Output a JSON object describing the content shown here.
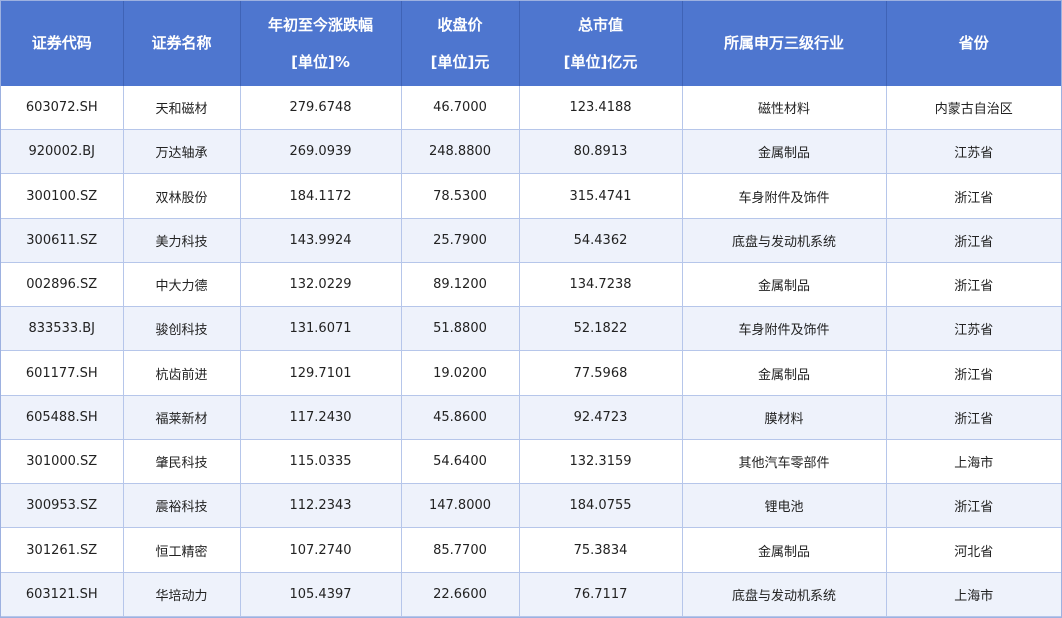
{
  "headers": [
    {
      "line1": "证券代码",
      "line2": ""
    },
    {
      "line1": "证券名称",
      "line2": ""
    },
    {
      "line1": "年初至今涨跌幅",
      "line2": "[单位]%"
    },
    {
      "line1": "收盘价",
      "line2": "[单位]元"
    },
    {
      "line1": "总市值",
      "line2": "[单位]亿元"
    },
    {
      "line1": "所属申万三级行业",
      "line2": ""
    },
    {
      "line1": "省份",
      "line2": ""
    }
  ],
  "rows": [
    [
      "603072.SH",
      "天和磁材",
      "279.6748",
      "46.7000",
      "123.4188",
      "磁性材料",
      "内蒙古自治区"
    ],
    [
      "920002.BJ",
      "万达轴承",
      "269.0939",
      "248.8800",
      "80.8913",
      "金属制品",
      "江苏省"
    ],
    [
      "300100.SZ",
      "双林股份",
      "184.1172",
      "78.5300",
      "315.4741",
      "车身附件及饰件",
      "浙江省"
    ],
    [
      "300611.SZ",
      "美力科技",
      "143.9924",
      "25.7900",
      "54.4362",
      "底盘与发动机系统",
      "浙江省"
    ],
    [
      "002896.SZ",
      "中大力德",
      "132.0229",
      "89.1200",
      "134.7238",
      "金属制品",
      "浙江省"
    ],
    [
      "833533.BJ",
      "骏创科技",
      "131.6071",
      "51.8800",
      "52.1822",
      "车身附件及饰件",
      "江苏省"
    ],
    [
      "601177.SH",
      "杭齿前进",
      "129.7101",
      "19.0200",
      "77.5968",
      "金属制品",
      "浙江省"
    ],
    [
      "605488.SH",
      "福莱新材",
      "117.2430",
      "45.8600",
      "92.4723",
      "膜材料",
      "浙江省"
    ],
    [
      "301000.SZ",
      "肇民科技",
      "115.0335",
      "54.6400",
      "132.3159",
      "其他汽车零部件",
      "上海市"
    ],
    [
      "300953.SZ",
      "震裕科技",
      "112.2343",
      "147.8000",
      "184.0755",
      "锂电池",
      "浙江省"
    ],
    [
      "301261.SZ",
      "恒工精密",
      "107.2740",
      "85.7700",
      "75.3834",
      "金属制品",
      "河北省"
    ],
    [
      "603121.SH",
      "华培动力",
      "105.4397",
      "22.6600",
      "76.7117",
      "底盘与发动机系统",
      "上海市"
    ]
  ]
}
